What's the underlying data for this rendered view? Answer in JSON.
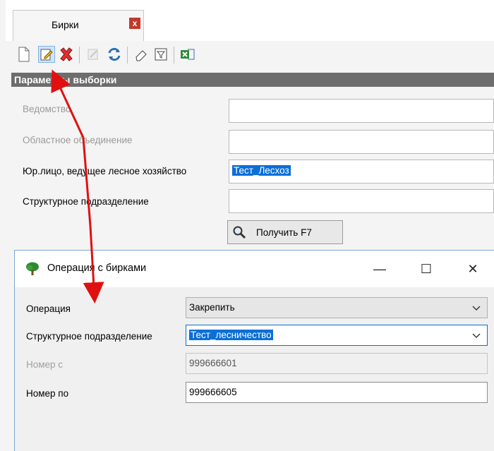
{
  "tab": {
    "label": "Бирки",
    "close_glyph": "x"
  },
  "toolbar": {
    "icons": [
      "new-document-icon",
      "edit-icon",
      "delete-icon",
      "disabled-icon",
      "refresh-icon",
      "eraser-icon",
      "filter-icon",
      "excel-export-icon"
    ]
  },
  "params_panel": {
    "title": "Параметры выборки",
    "fields": [
      {
        "label": "Ведомство",
        "value": "",
        "enabled": false
      },
      {
        "label": "Областное объединение",
        "value": "",
        "enabled": false
      },
      {
        "label": "Юр.лицо, ведущее лесное хозяйство",
        "value": "Тест_Лесхоз",
        "enabled": true,
        "selected": true
      },
      {
        "label": "Структурное подразделение",
        "value": "",
        "enabled": true
      }
    ],
    "get_button": "Получить F7"
  },
  "dialog": {
    "title": "Операция с бирками",
    "window_buttons": {
      "minimize": "—",
      "maximize": "☐",
      "close": "✕"
    },
    "fields": [
      {
        "label": "Операция",
        "value": "Закрепить",
        "type": "combo"
      },
      {
        "label": "Структурное подразделение",
        "value": "Тест_лесничество",
        "type": "combo",
        "selected": true
      },
      {
        "label": "Номер с",
        "value": "999666601",
        "type": "input",
        "enabled": false
      },
      {
        "label": "Номер по",
        "value": "999666605",
        "type": "input",
        "enabled": true
      }
    ]
  },
  "colors": {
    "selection": "#0a6fd8",
    "panel_header": "#6d6d6d",
    "annotation_arrow": "#e01010"
  }
}
